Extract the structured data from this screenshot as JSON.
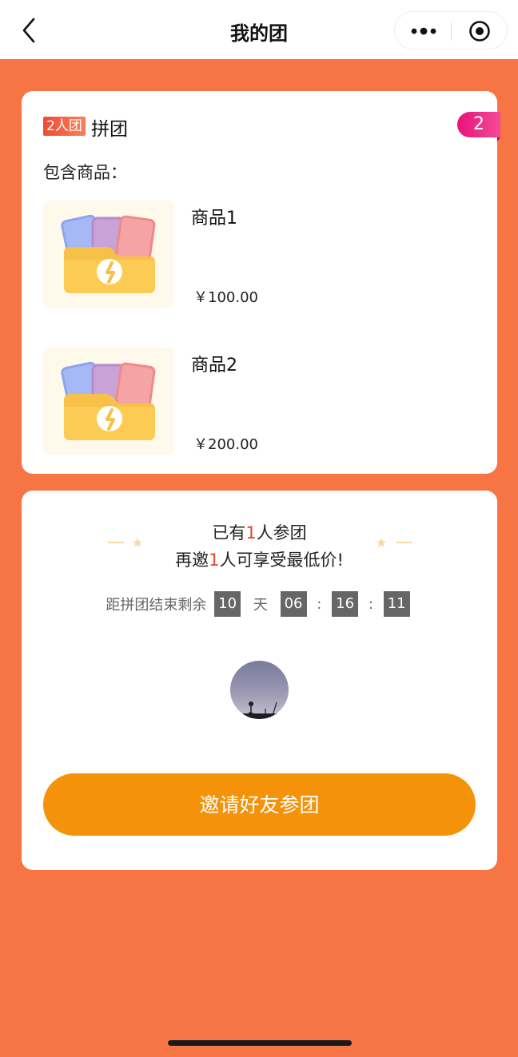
{
  "nav": {
    "title": "我的团"
  },
  "group": {
    "tag": "2人团",
    "title": "拼团",
    "badge": "2",
    "contains_label": "包含商品："
  },
  "products": [
    {
      "name": "商品1",
      "price": "￥100.00"
    },
    {
      "name": "商品2",
      "price": "￥200.00"
    }
  ],
  "status": {
    "line1_pre": "已有",
    "line1_num": "1",
    "line1_post": "人参团",
    "line2_pre": "再邀",
    "line2_num": "1",
    "line2_post": "人可享受最低价!"
  },
  "countdown": {
    "label": "距拼团结束剩余",
    "days": "10",
    "day_unit": "天",
    "hours": "06",
    "minutes": "16",
    "seconds": "11",
    "sep": ":"
  },
  "invite_button": "邀请好友参团",
  "colors": {
    "background": "#F77445",
    "accent": "#F4930A",
    "highlight": "#E8442A",
    "badge": "#E8127B"
  },
  "icons": {
    "back": "chevron-left-icon",
    "more": "more-dots-icon",
    "close": "target-circle-icon",
    "product": "folder-cards-icon"
  }
}
